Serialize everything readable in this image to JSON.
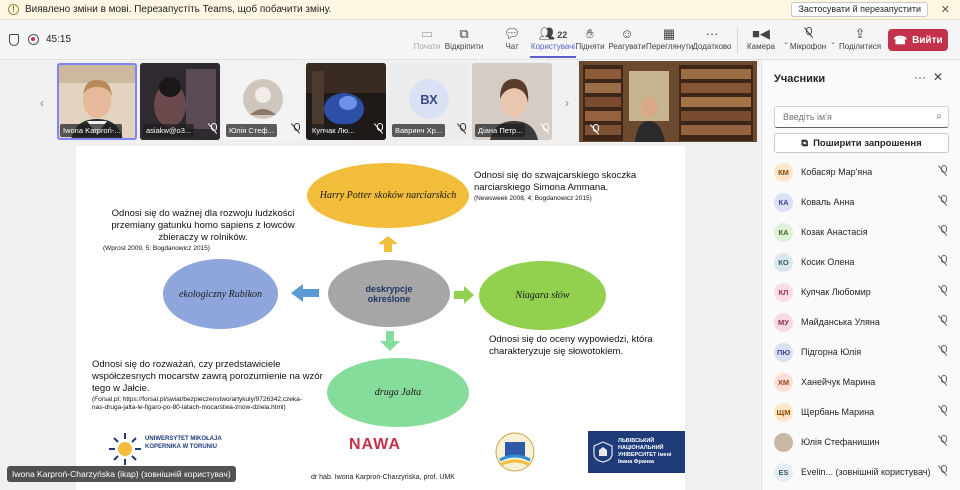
{
  "banner": {
    "message": "Виявлено зміни в мові. Перезапустіть Teams, щоб побачити зміну.",
    "apply_label": "Застосувати й перезапустити"
  },
  "meeting": {
    "timer": "45:15"
  },
  "toolbar": {
    "share_prev": "Почати",
    "open": "Відкріпити",
    "chat": "Чат",
    "people": "Користувачі",
    "people_count": "22",
    "raise": "Підняти",
    "react": "Реагувати",
    "view": "Переглянути",
    "more": "Додатково",
    "camera": "Камера",
    "mic": "Мікрофон",
    "share": "Поділитися",
    "leave": "Вийти"
  },
  "video_strip": [
    {
      "name": "Iwona Karproń-...",
      "selected": true
    },
    {
      "name": "asiakw@o3..."
    },
    {
      "name": "Юлія Стеф..."
    },
    {
      "name": "Купчак Лю..."
    },
    {
      "name": "Вавринч Хр...",
      "initials": "ВХ"
    },
    {
      "name": "Діана Петр..."
    }
  ],
  "slide": {
    "center": "deskrypcje określone",
    "top": "Harry Potter skoków narciarskich",
    "left": "ekologiczny Rubikon",
    "right": "Niagara słów",
    "bottom": "druga Jałta",
    "text_top_right": "Odnosi się do szwajcarskiego skoczka narciarskiego Simona Ammana.",
    "ref_top_right": "(Newsweek 2008, 4; Bogdanowicz 2015)",
    "text_left": "Odnosi się do ważnej dla rozwoju ludzkości przemiany gatunku homo sapiens z łowców zbieraczy w rolników.",
    "ref_left": "(Wprost 2009, 5; Bogdanowicz 2015)",
    "text_right": "Odnosi się do oceny wypowiedzi, która charakteryzuje się słowotokiem.",
    "text_bottom_left": "Odnosi się do rozważań, czy przedstawiciele współczesnych mocarstw zawrą porozumienie na wzór tego w Jałcie.",
    "ref_bottom_left": "(Forsal.pl; https://forsal.pl/swiat/bezpieczenstwo/artykuly/9726342,czeka-nas-druga-jalta-le-figaro-po-80-latach-mocarstwa-znow-dziela.html)",
    "logo_umk": "UNIWERSYTET MIKOŁAJA KOPERNIKA W TORUNIU",
    "logo_nawa": "NAWA",
    "logo_lviv": "ЛЬВІВСЬКИЙ НАЦІОНАЛЬНИЙ УНІВЕРСИТЕТ імені Івана Франка",
    "author": "dr hab. Iwona Karproń-Charzyńska, prof. UMK"
  },
  "caption": "Iwona Karproń-Charzyńska (ikap) (зовнішній користувач)",
  "panel": {
    "title": "Учасники",
    "search_placeholder": "Введіть ім'я",
    "share_invite": "Поширити запрошення",
    "participants": [
      {
        "initials": "КМ",
        "name": "Кобасяр Мар'яна",
        "bg": "#fde7c8",
        "fg": "#8a4b08"
      },
      {
        "initials": "КА",
        "name": "Коваль Анна",
        "bg": "#dbe1f5",
        "fg": "#3b4a8a"
      },
      {
        "initials": "КА",
        "name": "Козак Анастасія",
        "bg": "#dff1d6",
        "fg": "#3d6b1f"
      },
      {
        "initials": "КО",
        "name": "Косик Олена",
        "bg": "#d9e7ee",
        "fg": "#2e5b6e"
      },
      {
        "initials": "КЛ",
        "name": "Купчак Любомир",
        "bg": "#fbdde8",
        "fg": "#9a2f5c"
      },
      {
        "initials": "МУ",
        "name": "Майданська Уляна",
        "bg": "#f6d9e4",
        "fg": "#8a2d55"
      },
      {
        "initials": "ПЮ",
        "name": "Підгорна Юлія",
        "bg": "#dbe1f5",
        "fg": "#3b4a8a"
      },
      {
        "initials": "ХМ",
        "name": "Ханейчук Марина",
        "bg": "#fde0d5",
        "fg": "#9a3b1a"
      },
      {
        "initials": "ЩМ",
        "name": "Щербань Марина",
        "bg": "#fde7c8",
        "fg": "#8a4b08"
      },
      {
        "initials": "",
        "name": "Юлія Стефанишин",
        "bg": "#c9b8a6",
        "fg": "#fff"
      },
      {
        "initials": "ES",
        "name": "Evelin... (зовнішній користувач)",
        "bg": "#e5eef1",
        "fg": "#35606e"
      }
    ]
  },
  "colors": {
    "accent": "#5b5fc7",
    "leave": "#c4314b",
    "ellipse_top": "#f2bd3b",
    "ellipse_left": "#8fa6dc",
    "ellipse_center": "#a6a6a6",
    "ellipse_right": "#92d050",
    "ellipse_bottom": "#86dd9b"
  }
}
